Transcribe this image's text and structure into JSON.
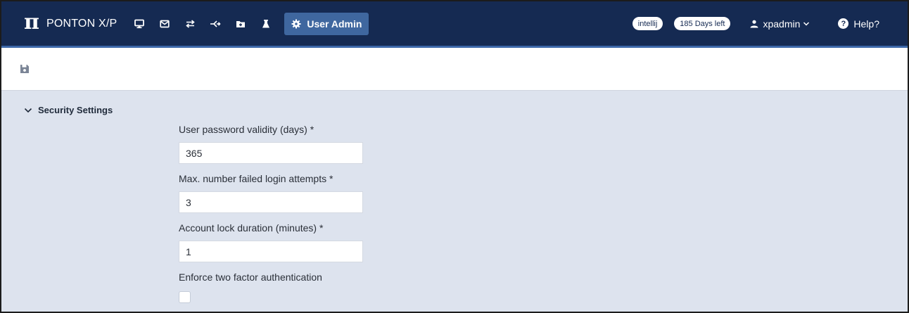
{
  "app": {
    "brand_symbol": "π",
    "brand_name": "PONTON X/P"
  },
  "nav": {
    "icons": [
      "monitor-icon",
      "envelope-icon",
      "transfer-icon",
      "route-icon",
      "folder-icon",
      "flask-icon"
    ],
    "active_label": "User Admin",
    "environment_badge": "intellij",
    "license_badge": "185 Days left",
    "user_name": "xpadmin",
    "help_label": "Help?"
  },
  "toolbar": {
    "save_icon": "floppy-disk-icon"
  },
  "section": {
    "title": "Security Settings",
    "fields": [
      {
        "label": "User password validity (days) *",
        "value": "365"
      },
      {
        "label": "Max. number failed login attempts *",
        "value": "3"
      },
      {
        "label": "Account lock duration (minutes) *",
        "value": "1"
      }
    ],
    "checkbox_label": "Enforce two factor authentication",
    "checkbox_checked": false
  },
  "colors": {
    "navbar": "#152a52",
    "active_tab": "#3f679f",
    "content_bg": "#dde3ee",
    "toolbar_bg": "#ffffff"
  }
}
